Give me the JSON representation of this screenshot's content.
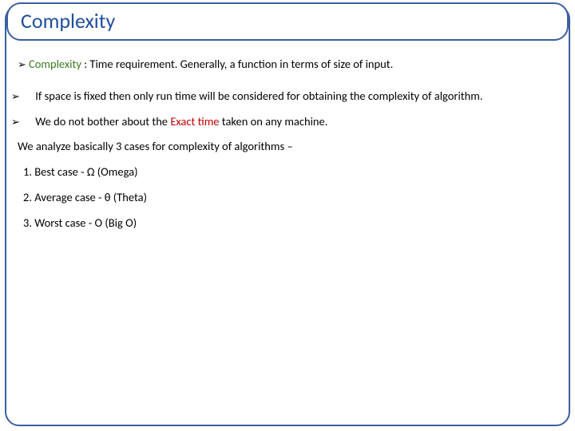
{
  "title": "Complexity",
  "bullet1": {
    "term": "Complexity",
    "rest": " : Time requirement. Generally, a function in terms of size of input."
  },
  "bullet2": "If space is fixed then only run time will be considered for obtaining the complexity of algorithm.",
  "bullet3": {
    "pre": "We do not bother about the ",
    "em": "Exact time",
    "post": " taken on any machine."
  },
  "para1": "We analyze basically 3 cases for complexity of algorithms –",
  "list": {
    "i1": "1.   Best case - Ω (Omega)",
    "i2": "2.   Average case - θ (Theta)",
    "i3": "3.   Worst case - O (Big O)"
  }
}
